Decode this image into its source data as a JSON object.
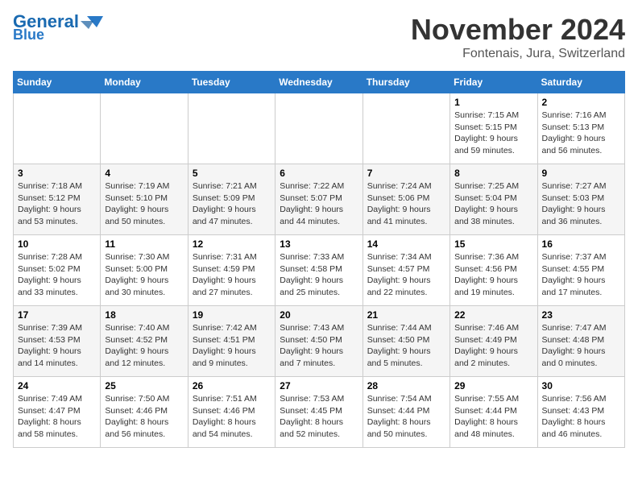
{
  "header": {
    "logo_line1": "General",
    "logo_line2": "Blue",
    "month_title": "November 2024",
    "location": "Fontenais, Jura, Switzerland"
  },
  "days_of_week": [
    "Sunday",
    "Monday",
    "Tuesday",
    "Wednesday",
    "Thursday",
    "Friday",
    "Saturday"
  ],
  "weeks": [
    [
      {
        "day": "",
        "info": ""
      },
      {
        "day": "",
        "info": ""
      },
      {
        "day": "",
        "info": ""
      },
      {
        "day": "",
        "info": ""
      },
      {
        "day": "",
        "info": ""
      },
      {
        "day": "1",
        "info": "Sunrise: 7:15 AM\nSunset: 5:15 PM\nDaylight: 9 hours\nand 59 minutes."
      },
      {
        "day": "2",
        "info": "Sunrise: 7:16 AM\nSunset: 5:13 PM\nDaylight: 9 hours\nand 56 minutes."
      }
    ],
    [
      {
        "day": "3",
        "info": "Sunrise: 7:18 AM\nSunset: 5:12 PM\nDaylight: 9 hours\nand 53 minutes."
      },
      {
        "day": "4",
        "info": "Sunrise: 7:19 AM\nSunset: 5:10 PM\nDaylight: 9 hours\nand 50 minutes."
      },
      {
        "day": "5",
        "info": "Sunrise: 7:21 AM\nSunset: 5:09 PM\nDaylight: 9 hours\nand 47 minutes."
      },
      {
        "day": "6",
        "info": "Sunrise: 7:22 AM\nSunset: 5:07 PM\nDaylight: 9 hours\nand 44 minutes."
      },
      {
        "day": "7",
        "info": "Sunrise: 7:24 AM\nSunset: 5:06 PM\nDaylight: 9 hours\nand 41 minutes."
      },
      {
        "day": "8",
        "info": "Sunrise: 7:25 AM\nSunset: 5:04 PM\nDaylight: 9 hours\nand 38 minutes."
      },
      {
        "day": "9",
        "info": "Sunrise: 7:27 AM\nSunset: 5:03 PM\nDaylight: 9 hours\nand 36 minutes."
      }
    ],
    [
      {
        "day": "10",
        "info": "Sunrise: 7:28 AM\nSunset: 5:02 PM\nDaylight: 9 hours\nand 33 minutes."
      },
      {
        "day": "11",
        "info": "Sunrise: 7:30 AM\nSunset: 5:00 PM\nDaylight: 9 hours\nand 30 minutes."
      },
      {
        "day": "12",
        "info": "Sunrise: 7:31 AM\nSunset: 4:59 PM\nDaylight: 9 hours\nand 27 minutes."
      },
      {
        "day": "13",
        "info": "Sunrise: 7:33 AM\nSunset: 4:58 PM\nDaylight: 9 hours\nand 25 minutes."
      },
      {
        "day": "14",
        "info": "Sunrise: 7:34 AM\nSunset: 4:57 PM\nDaylight: 9 hours\nand 22 minutes."
      },
      {
        "day": "15",
        "info": "Sunrise: 7:36 AM\nSunset: 4:56 PM\nDaylight: 9 hours\nand 19 minutes."
      },
      {
        "day": "16",
        "info": "Sunrise: 7:37 AM\nSunset: 4:55 PM\nDaylight: 9 hours\nand 17 minutes."
      }
    ],
    [
      {
        "day": "17",
        "info": "Sunrise: 7:39 AM\nSunset: 4:53 PM\nDaylight: 9 hours\nand 14 minutes."
      },
      {
        "day": "18",
        "info": "Sunrise: 7:40 AM\nSunset: 4:52 PM\nDaylight: 9 hours\nand 12 minutes."
      },
      {
        "day": "19",
        "info": "Sunrise: 7:42 AM\nSunset: 4:51 PM\nDaylight: 9 hours\nand 9 minutes."
      },
      {
        "day": "20",
        "info": "Sunrise: 7:43 AM\nSunset: 4:50 PM\nDaylight: 9 hours\nand 7 minutes."
      },
      {
        "day": "21",
        "info": "Sunrise: 7:44 AM\nSunset: 4:50 PM\nDaylight: 9 hours\nand 5 minutes."
      },
      {
        "day": "22",
        "info": "Sunrise: 7:46 AM\nSunset: 4:49 PM\nDaylight: 9 hours\nand 2 minutes."
      },
      {
        "day": "23",
        "info": "Sunrise: 7:47 AM\nSunset: 4:48 PM\nDaylight: 9 hours\nand 0 minutes."
      }
    ],
    [
      {
        "day": "24",
        "info": "Sunrise: 7:49 AM\nSunset: 4:47 PM\nDaylight: 8 hours\nand 58 minutes."
      },
      {
        "day": "25",
        "info": "Sunrise: 7:50 AM\nSunset: 4:46 PM\nDaylight: 8 hours\nand 56 minutes."
      },
      {
        "day": "26",
        "info": "Sunrise: 7:51 AM\nSunset: 4:46 PM\nDaylight: 8 hours\nand 54 minutes."
      },
      {
        "day": "27",
        "info": "Sunrise: 7:53 AM\nSunset: 4:45 PM\nDaylight: 8 hours\nand 52 minutes."
      },
      {
        "day": "28",
        "info": "Sunrise: 7:54 AM\nSunset: 4:44 PM\nDaylight: 8 hours\nand 50 minutes."
      },
      {
        "day": "29",
        "info": "Sunrise: 7:55 AM\nSunset: 4:44 PM\nDaylight: 8 hours\nand 48 minutes."
      },
      {
        "day": "30",
        "info": "Sunrise: 7:56 AM\nSunset: 4:43 PM\nDaylight: 8 hours\nand 46 minutes."
      }
    ]
  ]
}
